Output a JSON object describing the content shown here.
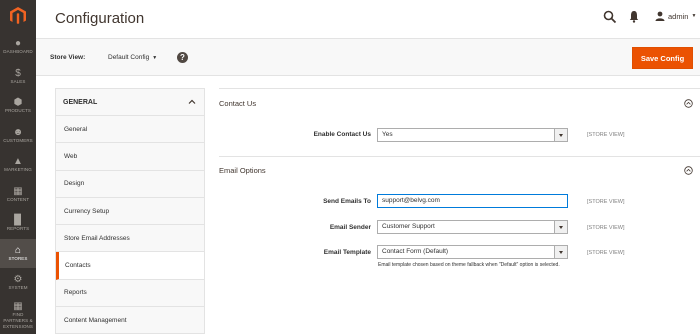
{
  "nav": {
    "items": [
      {
        "icon": "dashboard-icon",
        "label": "DASHBOARD"
      },
      {
        "icon": "dollar-icon",
        "label": "SALES"
      },
      {
        "icon": "cube-icon",
        "label": "PRODUCTS"
      },
      {
        "icon": "user-icon",
        "label": "CUSTOMERS"
      },
      {
        "icon": "megaphone-icon",
        "label": "MARKETING"
      },
      {
        "icon": "content-icon",
        "label": "CONTENT"
      },
      {
        "icon": "bar-chart-icon",
        "label": "REPORTS"
      },
      {
        "icon": "store-icon",
        "label": "STORES"
      },
      {
        "icon": "gear-icon",
        "label": "SYSTEM"
      },
      {
        "icon": "extensions-icon",
        "label": "FIND PARTNERS & EXTENSIONS"
      }
    ],
    "active": "STORES"
  },
  "header": {
    "title": "Configuration",
    "user": "admin"
  },
  "scope_bar": {
    "label": "Store View:",
    "value": "Default Config",
    "save_label": "Save Config"
  },
  "tabs": {
    "group": "GENERAL",
    "items": [
      "General",
      "Web",
      "Design",
      "Currency Setup",
      "Store Email Addresses",
      "Contacts",
      "Reports",
      "Content Management"
    ],
    "active": "Contacts"
  },
  "sections": {
    "contact_us": {
      "title": "Contact Us",
      "enable_label": "Enable Contact Us",
      "enable_value": "Yes",
      "enable_scope": "[STORE VIEW]"
    },
    "email_options": {
      "title": "Email Options",
      "send_to_label": "Send Emails To",
      "send_to_value": "support@belvg.com",
      "send_to_scope": "[STORE VIEW]",
      "sender_label": "Email Sender",
      "sender_value": "Customer Support",
      "sender_scope": "[STORE VIEW]",
      "template_label": "Email Template",
      "template_value": "Contact Form (Default)",
      "template_scope": "[STORE VIEW]",
      "template_note": "Email template chosen based on theme fallback when \"Default\" option is selected."
    }
  },
  "colors": {
    "nav_bg": "#373330",
    "accent": "#eb5202",
    "logo": "#f26322"
  }
}
